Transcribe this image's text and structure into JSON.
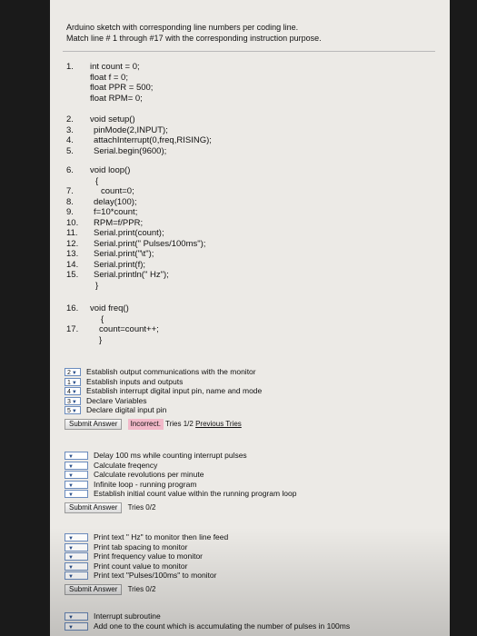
{
  "header": {
    "line1": "Arduino sketch with corresponding line numbers per coding line.",
    "line2": "Match line # 1 through #17 with the corresponding instruction purpose."
  },
  "code": [
    {
      "num": "1.",
      "text": "int count = 0;"
    },
    {
      "num": "",
      "text": "float f = 0;"
    },
    {
      "num": "",
      "text": "float PPR = 500;"
    },
    {
      "num": "",
      "text": "float RPM= 0;"
    },
    {
      "num": "2.",
      "text": "void setup()"
    },
    {
      "num": "3.",
      "text": "pinMode(2,INPUT);"
    },
    {
      "num": "4.",
      "text": "attachInterrupt(0,freq,RISING);"
    },
    {
      "num": "5.",
      "text": "Serial.begin(9600);"
    },
    {
      "num": "6.",
      "text": "void loop()"
    },
    {
      "num": "",
      "text": "{"
    },
    {
      "num": "7.",
      "text": "count=0;"
    },
    {
      "num": "8.",
      "text": "delay(100);"
    },
    {
      "num": "9.",
      "text": "f=10*count;"
    },
    {
      "num": "10.",
      "text": "RPM=f/PPR;"
    },
    {
      "num": "11.",
      "text": "Serial.print(count);"
    },
    {
      "num": "12.",
      "text": "Serial.print(\" Pulses/100ms\");"
    },
    {
      "num": "13.",
      "text": "Serial.print(\"\\t\");"
    },
    {
      "num": "14.",
      "text": "Serial.print(f);"
    },
    {
      "num": "15.",
      "text": "Serial.println(\" Hz\");"
    },
    {
      "num": "",
      "text": "}"
    },
    {
      "num": "16.",
      "text": "void freq()"
    },
    {
      "num": "",
      "text": "{"
    },
    {
      "num": "17.",
      "text": "count=count++;"
    },
    {
      "num": "",
      "text": "}"
    }
  ],
  "question1": {
    "items": [
      {
        "value": "2",
        "label": "Establish output communications with the monitor"
      },
      {
        "value": "1",
        "label": "Establish inputs and outputs"
      },
      {
        "value": "4",
        "label": "Establish interrupt digital input pin, name and mode"
      },
      {
        "value": "3",
        "label": "Declare Variables"
      },
      {
        "value": "5",
        "label": "Declare digital input pin"
      }
    ],
    "submit": "Submit Answer",
    "status": "Incorrect.",
    "tries": "Tries 1/2",
    "previous": "Previous Tries"
  },
  "question2": {
    "items": [
      {
        "value": "",
        "label": "Delay 100 ms while counting interrupt pulses"
      },
      {
        "value": "",
        "label": "Calculate freqency"
      },
      {
        "value": "",
        "label": "Calculate revolutions per minute"
      },
      {
        "value": "",
        "label": "Infinite loop - running program"
      },
      {
        "value": "",
        "label": "Establish initial count value within the running program loop"
      }
    ],
    "submit": "Submit Answer",
    "tries": "Tries 0/2"
  },
  "question3": {
    "items": [
      {
        "value": "",
        "label": "Print text \" Hz\" to monitor then line feed"
      },
      {
        "value": "",
        "label": "Print tab spacing to monitor"
      },
      {
        "value": "",
        "label": "Print frequency value to monitor"
      },
      {
        "value": "",
        "label": "Print count value to monitor"
      },
      {
        "value": "",
        "label": "Print text \"Pulses/100ms\" to monitor"
      }
    ],
    "submit": "Submit Answer",
    "tries": "Tries 0/2"
  },
  "question4": {
    "items": [
      {
        "value": "",
        "label": "Interrupt subroutine"
      },
      {
        "value": "",
        "label": "Add one to the count which is accumulating the number of pulses in 100ms"
      }
    ]
  }
}
